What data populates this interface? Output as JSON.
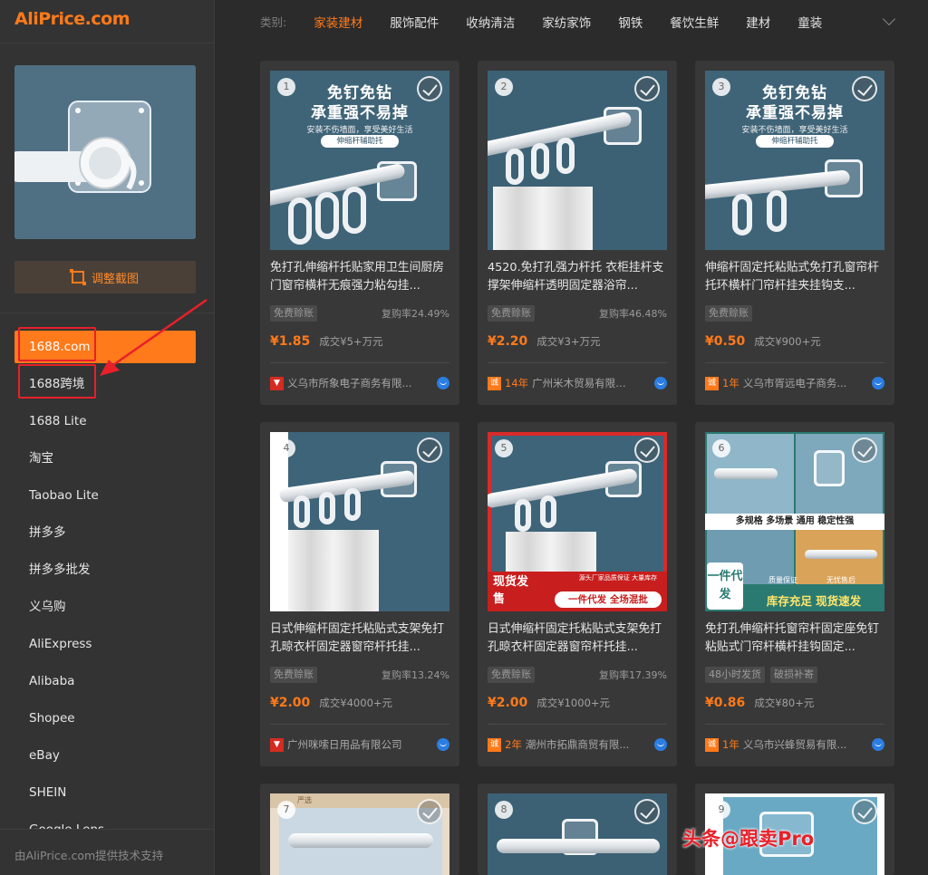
{
  "app": {
    "logo": "AliPrice.com"
  },
  "sidebar": {
    "crop_button": "调整截图",
    "platforms": [
      "1688.com",
      "1688跨境",
      "1688 Lite",
      "淘宝",
      "Taobao Lite",
      "拼多多",
      "拼多多批发",
      "义乌购",
      "AliExpress",
      "Alibaba",
      "Shopee",
      "eBay",
      "SHEIN",
      "Google Lens"
    ],
    "active_platform": "1688.com",
    "footer": "由AliPrice.com提供技术支持"
  },
  "categories": {
    "label": "类别:",
    "items": [
      "家装建材",
      "服饰配件",
      "收纳清洁",
      "家纺家饰",
      "钢铁",
      "餐饮生鲜",
      "建材",
      "童装"
    ],
    "active": "家装建材"
  },
  "products": [
    {
      "index": "1",
      "image_promo": "免钉免钻",
      "image_promo2": "承重强不易掉",
      "image_sub": "安装不伤墙面，享受美好生活",
      "image_pill": "伸缩杆辅助托",
      "title": "免打孔伸缩杆托贴家用卫生间厨房门窗帘横杆无痕强力粘勾挂...",
      "tags": [
        "免费赊账"
      ],
      "repurchase": "复购率24.49%",
      "price": "¥1.85",
      "deals": "成交¥5+万元",
      "seller_badge": "",
      "seller_years": "",
      "seller": "义乌市所象电子商务有限..."
    },
    {
      "index": "2",
      "title": "4520.免打孔强力杆托 衣柜挂杆支撑架伸缩杆透明固定器浴帘...",
      "tags": [
        "免费赊账"
      ],
      "repurchase": "复购率46.48%",
      "price": "¥2.20",
      "deals": "成交¥3+万元",
      "seller_badge": "诚",
      "seller_years": "14年",
      "seller": "广州米木贸易有限公..."
    },
    {
      "index": "3",
      "image_promo": "免钉免钻",
      "image_promo2": "承重强不易掉",
      "image_sub": "安装不伤墙面，享受美好生活",
      "image_pill": "伸缩杆辅助托",
      "title": "伸缩杆固定托粘贴式免打孔窗帘杆托环横杆门帘杆挂夹挂钩支...",
      "tags": [
        "免费赊账"
      ],
      "repurchase": "",
      "price": "¥0.50",
      "deals": "成交¥900+元",
      "seller_badge": "诚",
      "seller_years": "1年",
      "seller": "义乌市胥远电子商务..."
    },
    {
      "index": "4",
      "title": "日式伸缩杆固定托粘贴式支架免打孔晾衣杆固定器窗帘杆托挂...",
      "tags": [
        "免费赊账"
      ],
      "repurchase": "复购率13.24%",
      "price": "¥2.00",
      "deals": "成交¥4000+元",
      "seller_badge": "",
      "seller_years": "",
      "seller": "广州咪嗦日用品有限公司"
    },
    {
      "index": "5",
      "image_banner": "现货发售",
      "image_banner2": "源头厂家品质保证 大量库存",
      "image_banner3": "一件代发 全场混批",
      "title": "日式伸缩杆固定托粘贴式支架免打孔晾衣杆固定器窗帘杆托挂...",
      "tags": [
        "免费赊账"
      ],
      "repurchase": "复购率17.39%",
      "price": "¥2.00",
      "deals": "成交¥1000+元",
      "seller_badge": "诚",
      "seller_years": "2年",
      "seller": "潮州市拓鼎商贸有限..."
    },
    {
      "index": "6",
      "image_banner": "多规格 多场景 通用 稳定性强",
      "image_banner2": "一件代发",
      "image_banner3": "库存充足 现货速发",
      "image_banner4": "质量保证",
      "image_banner5": "无忧售后",
      "title": "免打孔伸缩杆托窗帘杆固定座免钉粘贴式门帘杆横杆挂钩固定...",
      "tags": [
        "48小时发货",
        "破损补寄"
      ],
      "repurchase": "",
      "price": "¥0.86",
      "deals": "成交¥80+元",
      "seller_badge": "诚",
      "seller_years": "1年",
      "seller": "义乌市兴蜂贸易有限..."
    },
    {
      "index": "7",
      "image_label": "严选"
    },
    {
      "index": "8"
    },
    {
      "index": "9"
    }
  ],
  "watermark": "头条@跟卖Pro",
  "colors": {
    "accent": "#ff7a1a",
    "background": "#2b2b2b",
    "card": "#383838",
    "highlight": "#e8202a"
  }
}
